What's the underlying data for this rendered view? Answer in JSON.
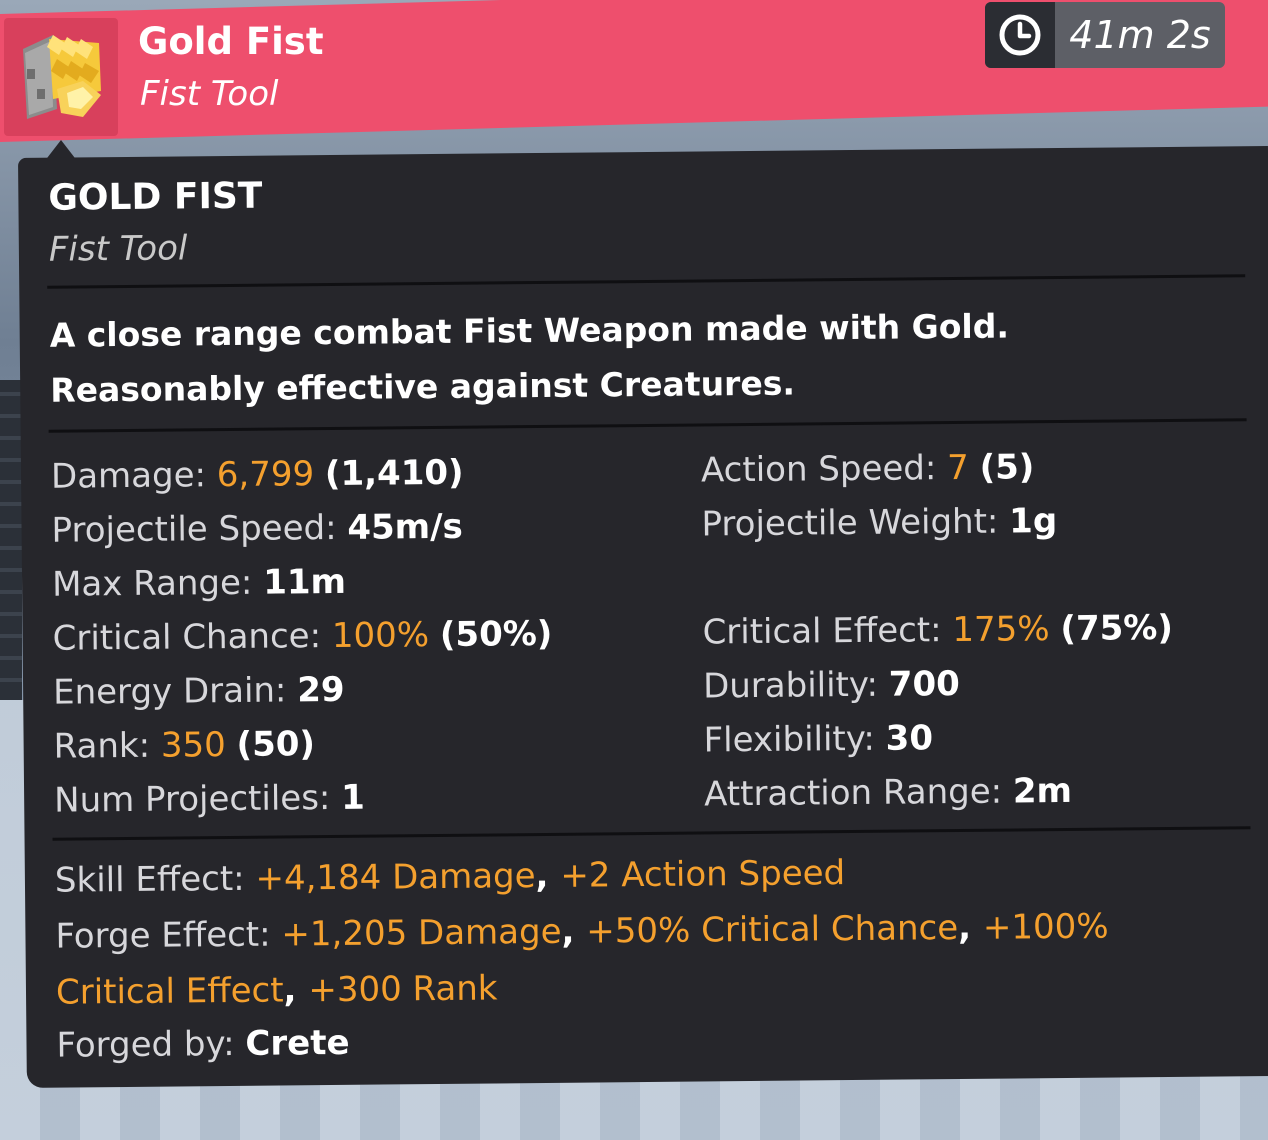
{
  "header": {
    "name": "Gold Fist",
    "type": "Fist Tool",
    "icon": "gold-fist-icon",
    "color": "#ee4f6d"
  },
  "timer": {
    "icon": "clock-icon",
    "text": "41m 2s"
  },
  "tooltip": {
    "title": "GOLD FIST",
    "type": "Fist Tool",
    "description_line1": "A close range combat Fist Weapon made with Gold.",
    "description_line2": "Reasonably effective against Creatures.",
    "highlight_color": "#f4a02e",
    "stats_left": [
      {
        "label": "Damage:",
        "value": "6,799",
        "highlight": true,
        "extra": "(1,410)"
      },
      {
        "label": "Projectile Speed:",
        "value": "45m/s",
        "highlight": false,
        "extra": ""
      },
      {
        "label": "Max Range:",
        "value": "11m",
        "highlight": false,
        "extra": ""
      },
      {
        "label": "Critical Chance:",
        "value": "100%",
        "highlight": true,
        "extra": "(50%)"
      },
      {
        "label": "Energy Drain:",
        "value": "29",
        "highlight": false,
        "extra": ""
      },
      {
        "label": "Rank:",
        "value": "350",
        "highlight": true,
        "extra": "(50)"
      },
      {
        "label": "Num Projectiles:",
        "value": "1",
        "highlight": false,
        "extra": ""
      }
    ],
    "stats_right": [
      {
        "label": "Action Speed:",
        "value": "7",
        "highlight": true,
        "extra": "(5)"
      },
      {
        "label": "Projectile Weight:",
        "value": "1g",
        "highlight": false,
        "extra": ""
      },
      {
        "label": "",
        "value": "",
        "highlight": false,
        "extra": ""
      },
      {
        "label": "Critical Effect:",
        "value": "175%",
        "highlight": true,
        "extra": "(75%)"
      },
      {
        "label": "Durability:",
        "value": "700",
        "highlight": false,
        "extra": ""
      },
      {
        "label": "Flexibility:",
        "value": "30",
        "highlight": false,
        "extra": ""
      },
      {
        "label": "Attraction Range:",
        "value": "2m",
        "highlight": false,
        "extra": ""
      }
    ],
    "skill_effect": {
      "label": "Skill Effect:",
      "parts": [
        "+4,184 Damage",
        "+2 Action Speed"
      ]
    },
    "forge_effect": {
      "label": "Forge Effect:",
      "line1_parts": [
        "+1,205 Damage",
        "+50% Critical Chance",
        "+100%"
      ],
      "line2_parts": [
        "Critical Effect",
        "+300 Rank"
      ]
    },
    "forged_by": {
      "label": "Forged by:",
      "value": "Crete"
    }
  }
}
